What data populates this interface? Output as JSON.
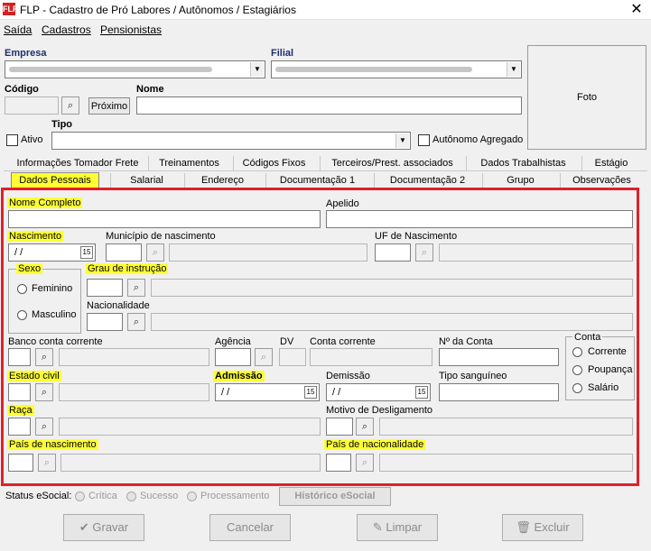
{
  "window": {
    "title": "FLP - Cadastro de Pró Labores / Autônomos / Estagiários",
    "app_icon": "FLP"
  },
  "menu": [
    "Saída",
    "Cadastros",
    "Pensionistas"
  ],
  "header": {
    "empresa_label": "Empresa",
    "filial_label": "Filial",
    "codigo_label": "Código",
    "nome_label": "Nome",
    "proximo_label": "Próximo",
    "tipo_label": "Tipo",
    "ativo_label": "Ativo",
    "autonomo_label": "Autônomo Agregado",
    "foto_label": "Foto"
  },
  "tabs_row1": [
    "Informações Tomador Frete",
    "Treinamentos",
    "Códigos Fixos",
    "Terceiros/Prest. associados",
    "Dados Trabalhistas",
    "Estágio"
  ],
  "tabs_row2": [
    "Dados Pessoais",
    "Salarial",
    "Endereço",
    "Documentação 1",
    "Documentação 2",
    "Grupo",
    "Observações"
  ],
  "form": {
    "nome_completo": "Nome Completo",
    "apelido": "Apelido",
    "nascimento": "Nascimento",
    "nascimento_value": " / /",
    "municipio": "Município de nascimento",
    "uf_nascimento": "UF de Nascimento",
    "sexo": "Sexo",
    "feminino": "Feminino",
    "masculino": "Masculino",
    "grau_instrucao": "Grau de instrução",
    "nacionalidade": "Nacionalidade",
    "banco": "Banco conta corrente",
    "agencia": "Agência",
    "dv": "DV",
    "conta_corrente": "Conta corrente",
    "n_conta": "Nº da Conta",
    "conta_group": "Conta",
    "conta_options": [
      "Corrente",
      "Poupança",
      "Salário"
    ],
    "estado_civil": "Estado civil",
    "admissao": "Admissão",
    "admissao_value": " / /",
    "demissao": "Demissão",
    "demissao_value": " / /",
    "tipo_sanguineo": "Tipo sanguíneo",
    "raca": "Raça",
    "motivo_desligamento": "Motivo de Desligamento",
    "pais_nascimento": "País de nascimento",
    "pais_nacionalidade": "País de nacionalidade"
  },
  "status": {
    "label": "Status eSocial:",
    "options": [
      "Crítica",
      "Sucesso",
      "Processamento"
    ],
    "historico": "Histórico eSocial"
  },
  "buttons": {
    "gravar": "Gravar",
    "cancelar": "Cancelar",
    "limpar": "Limpar",
    "excluir": "Excluir"
  },
  "colors": {
    "highlight": "#ffff33",
    "annotation_border": "#e0202a",
    "app_icon": "#d32020"
  }
}
